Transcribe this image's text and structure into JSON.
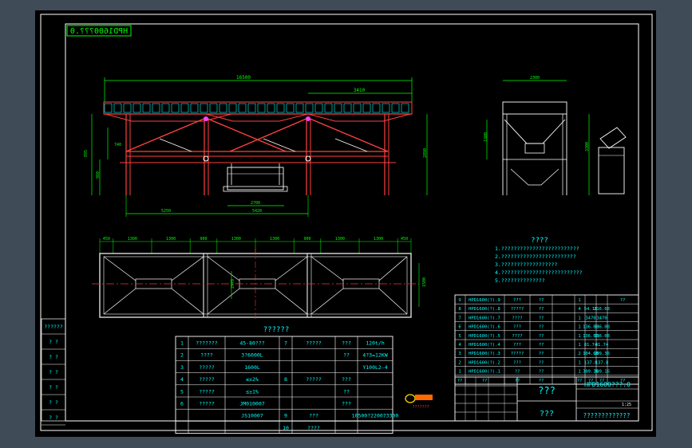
{
  "colors": {
    "app_bg": "#3f4b57",
    "canvas_bg": "#000000",
    "frame": "#ffffff",
    "green": "#00ff00",
    "cyan": "#00ffff",
    "red": "#ff3030",
    "white": "#ffffff",
    "yellow": "#ffd200"
  },
  "drawing": {
    "mirrored_title": "HPD1600???.0",
    "dims": {
      "front_overall": "16500",
      "front_right": "3410",
      "front_height": "2890",
      "front_left_h": "895",
      "front_left_h2": "960",
      "front_small_left": "740",
      "front_bottom_left": "5250",
      "front_bottom_mid": "2700",
      "front_bottom_center": "5420",
      "side_width": "2300",
      "side_left_h": "1300",
      "side_right_h": "3300"
    },
    "plan_dims": [
      "450",
      "1300",
      "1300",
      "900",
      "1300",
      "1300",
      "900",
      "1300",
      "1300",
      "450"
    ],
    "plan_side_left": "2970",
    "plan_side_right": "1500"
  },
  "notes": {
    "title": "????",
    "lines": [
      "1.?????????????????????????",
      "2.????????????????????????",
      "3.??????????????????",
      "4.??????????????????????????",
      "5.??????????????"
    ]
  },
  "spec_table": {
    "title": "??????",
    "rows": [
      {
        "no": "1",
        "name": "???????",
        "value": "45-80???",
        "no2": "7",
        "name2": "?????",
        "k": "???",
        "v": "120t/h"
      },
      {
        "no": "2",
        "name": "????",
        "value": "3?6000L",
        "no2": "",
        "name2": "",
        "k": "??",
        "v": "4?3=12KW"
      },
      {
        "no": "3",
        "name": "?????",
        "value": "1600L",
        "no2": "",
        "name2": "",
        "k": "",
        "v": "Y100L2-4"
      },
      {
        "no": "4",
        "name": "?????",
        "value": "≤±2%",
        "no2": "8",
        "name2": "?????",
        "k": "???",
        "v": ""
      },
      {
        "no": "5",
        "name": "?????",
        "value": "≤±1%",
        "no2": "",
        "name2": "",
        "k": "??",
        "v": ""
      },
      {
        "no": "6",
        "name": "?????",
        "value": "JM010007",
        "no2": "",
        "name2": "",
        "k": "???",
        "v": ""
      },
      {
        "no": "",
        "name": "",
        "value": "JS10007",
        "no2": "9",
        "name2": "???",
        "k": "",
        "v": "10500?220073300"
      },
      {
        "no": "",
        "name": "",
        "value": "",
        "no2": "10",
        "name2": "????",
        "k": "",
        "v": ""
      }
    ]
  },
  "parts_table": {
    "rows": [
      {
        "no": "9",
        "code": "HPD1600(?).9",
        "name": "???",
        "mat": "??",
        "qty": "1",
        "w1": "",
        "w2": "",
        "remark": "??"
      },
      {
        "no": "8",
        "code": "HPD1600(?).8",
        "name": "?????",
        "mat": "??",
        "qty": "4",
        "w1": "54.18",
        "w2": "216.68",
        "remark": ""
      },
      {
        "no": "7",
        "code": "HPD1600(?).7",
        "name": "????",
        "mat": "??",
        "qty": "1",
        "w1": "3470",
        "w2": "3470",
        "remark": ""
      },
      {
        "no": "6",
        "code": "HPD1600(?).6",
        "name": "???",
        "mat": "??",
        "qty": "1",
        "w1": "136.08",
        "w2": "136.08",
        "remark": ""
      },
      {
        "no": "5",
        "code": "HPD1600(?).5",
        "name": "????",
        "mat": "??",
        "qty": "1",
        "w1": "136.08",
        "w2": "136.08",
        "remark": ""
      },
      {
        "no": "4",
        "code": "HPD1600(?).4",
        "name": "???",
        "mat": "??",
        "qty": "1",
        "w1": "81.74",
        "w2": "81.74",
        "remark": ""
      },
      {
        "no": "3",
        "code": "HPD1600(?).3",
        "name": "?????",
        "mat": "??",
        "qty": "2",
        "w1": "104.68",
        "w2": "209.36",
        "remark": ""
      },
      {
        "no": "2",
        "code": "HPD1600(?).2",
        "name": "???",
        "mat": "??",
        "qty": "1",
        "w1": "137.8",
        "w2": "137.8",
        "remark": ""
      },
      {
        "no": "1",
        "code": "HPD1600(?).1",
        "name": "??",
        "mat": "??",
        "qty": "1",
        "w1": "309.16",
        "w2": "309.16",
        "remark": ""
      }
    ],
    "header": {
      "no": "??",
      "code": "??",
      "name": "??",
      "mat": "??",
      "qty": "??",
      "w1": "??",
      "w2": "??",
      "remark": "??"
    }
  },
  "title_block": {
    "name1": "???",
    "name2": "???",
    "drawing_no": "HPD1600???.0",
    "company": "?????????????",
    "scale_label": "1:25",
    "logo_text": "???????"
  },
  "left_block": {
    "labels": [
      "??????",
      "? ?",
      "? ?",
      "? ?",
      "? ?",
      "? ?",
      "? ?"
    ]
  }
}
